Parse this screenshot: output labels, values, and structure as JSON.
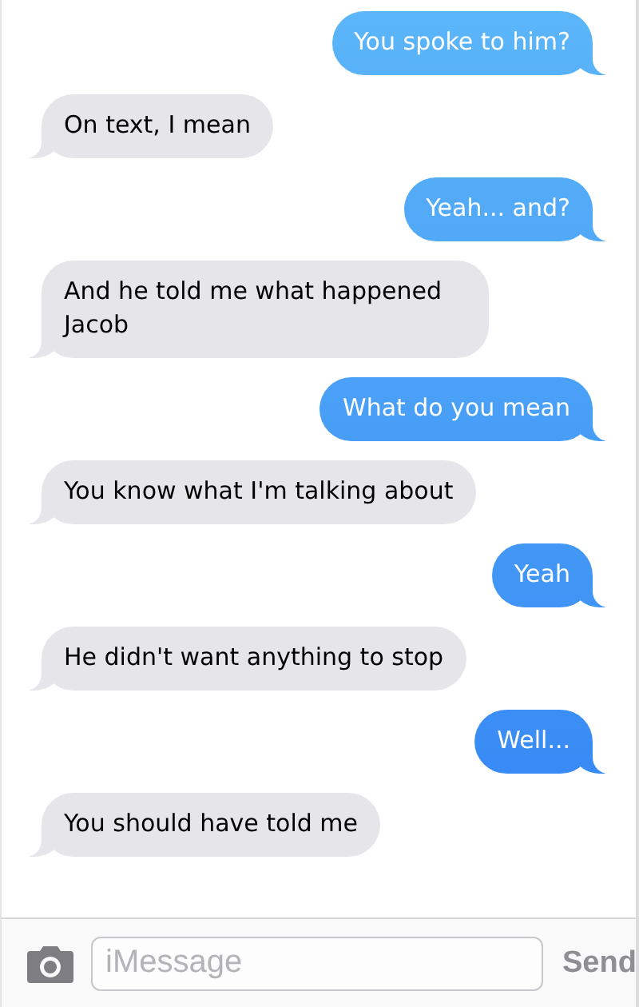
{
  "messages": [
    {
      "kind": "sent",
      "text": "You spoke to him?"
    },
    {
      "kind": "received",
      "text": "On text, I mean"
    },
    {
      "kind": "sent",
      "text": "Yeah... and?"
    },
    {
      "kind": "received",
      "text": "And he told me what happened Jacob"
    },
    {
      "kind": "sent",
      "text": "What do you mean"
    },
    {
      "kind": "received",
      "text": "You know what I'm talking about"
    },
    {
      "kind": "sent",
      "text": "Yeah"
    },
    {
      "kind": "received",
      "text": "He didn't want anything to stop"
    },
    {
      "kind": "sent",
      "text": "Well..."
    },
    {
      "kind": "received",
      "text": "You should have told me"
    }
  ],
  "composer": {
    "placeholder": "iMessage",
    "send": "Send"
  }
}
